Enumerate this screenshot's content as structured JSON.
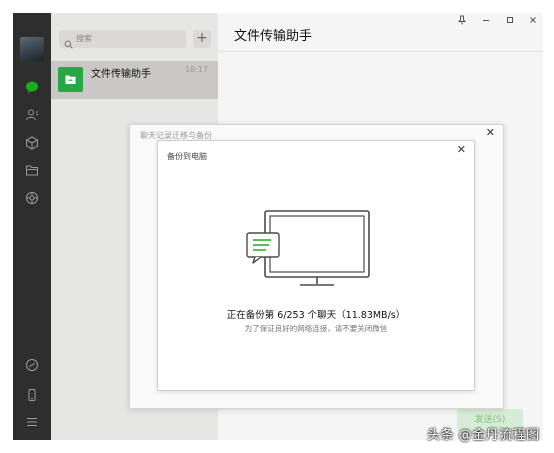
{
  "window": {
    "title": "文件传输助手"
  },
  "nav": {
    "icons": [
      "avatar",
      "chat-icon",
      "contacts-icon",
      "favorites-icon",
      "files-icon",
      "moments-icon",
      "miniprogram-icon",
      "phone-icon",
      "menu-icon"
    ],
    "active": "chat-icon",
    "accent": "#1aad19"
  },
  "search": {
    "placeholder": "搜索",
    "add_label": "+"
  },
  "chats": [
    {
      "name": "文件传输助手",
      "time": "18:17"
    }
  ],
  "window_controls": [
    "pin-icon",
    "minimize-icon",
    "maximize-icon",
    "close-icon"
  ],
  "send_button": "发送(S)",
  "migration_dialog": {
    "title": "聊天记录迁移与备份",
    "backup_dialog": {
      "title": "备份到电脑",
      "progress": "正在备份第 6/253 个聊天（11.83MB/s）",
      "hint": "为了保证良好的网络连接，请不要关闭微信"
    }
  },
  "watermark": "头条 @金丹流程图"
}
